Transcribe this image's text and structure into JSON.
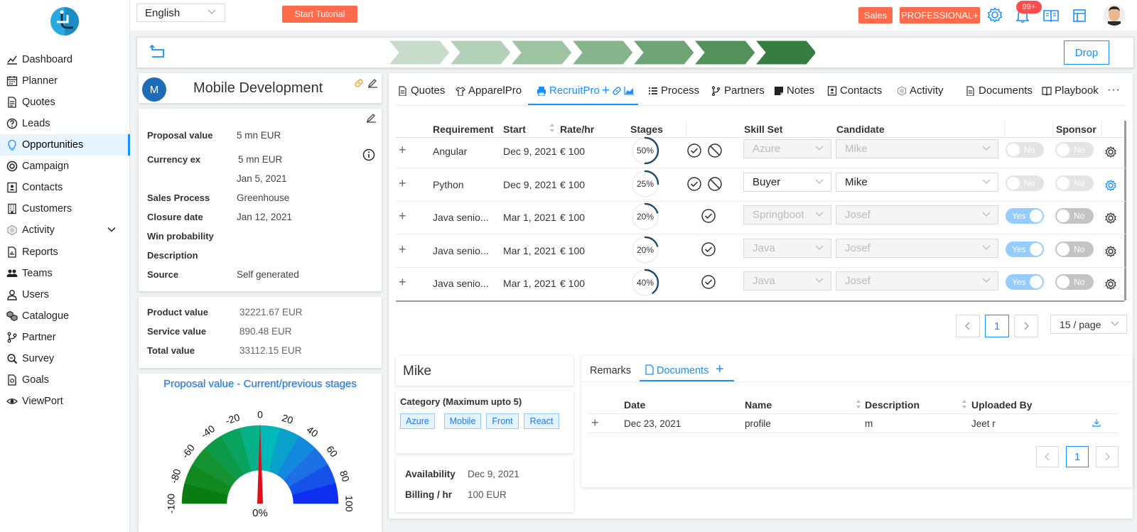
{
  "topbar": {
    "language": "English",
    "tutorial_label": "Start Tutorial",
    "sales_badge": "Sales",
    "plan_badge": "PROFESSIONAL+",
    "notifications_count": "99+"
  },
  "sidebar": {
    "items": [
      {
        "label": "Dashboard",
        "icon": "chart-line-icon"
      },
      {
        "label": "Planner",
        "icon": "calendar-icon"
      },
      {
        "label": "Quotes",
        "icon": "document-icon"
      },
      {
        "label": "Leads",
        "icon": "question-circle-icon"
      },
      {
        "label": "Opportunities",
        "icon": "bulb-icon"
      },
      {
        "label": "Campaign",
        "icon": "target-icon"
      },
      {
        "label": "Contacts",
        "icon": "contact-card-icon"
      },
      {
        "label": "Customers",
        "icon": "building-icon"
      },
      {
        "label": "Activity",
        "icon": "hexagon-icon"
      },
      {
        "label": "Reports",
        "icon": "report-icon"
      },
      {
        "label": "Teams",
        "icon": "team-icon"
      },
      {
        "label": "Users",
        "icon": "user-icon"
      },
      {
        "label": "Catalogue",
        "icon": "cubes-icon"
      },
      {
        "label": "Partner",
        "icon": "branch-icon"
      },
      {
        "label": "Survey",
        "icon": "search-doc-icon"
      },
      {
        "label": "Goals",
        "icon": "goal-doc-icon"
      },
      {
        "label": "ViewPort",
        "icon": "eye-icon"
      }
    ],
    "active": "Opportunities"
  },
  "stagebar": {
    "drop_label": "Drop",
    "stage_colors": [
      "#c7dccb",
      "#b3d0b8",
      "#9dc3a3",
      "#86b48d",
      "#6fa576",
      "#52915b",
      "#367d42"
    ]
  },
  "opportunity": {
    "avatar_letter": "M",
    "title": "Mobile Development",
    "details": [
      {
        "label": "Proposal value",
        "value": "5 mn EUR"
      },
      {
        "label": "Currency ex",
        "value": "5 mn EUR"
      },
      {
        "label": "",
        "value": "Jan 5, 2021"
      },
      {
        "label": "Sales Process",
        "value": "Greenhouse"
      },
      {
        "label": "Closure date",
        "value": "Jan 12, 2021"
      },
      {
        "label": "Win probability",
        "value": ""
      },
      {
        "label": "Description",
        "value": ""
      },
      {
        "label": "Source",
        "value": "Self generated"
      }
    ],
    "values": [
      {
        "label": "Product value",
        "value": "32221.67 EUR"
      },
      {
        "label": "Service value",
        "value": "890.48 EUR"
      },
      {
        "label": "Total value",
        "value": "33112.15 EUR"
      }
    ]
  },
  "gauge": {
    "title": "Proposal value - Current/previous stages",
    "ticks": [
      "-100",
      "-80",
      "-60",
      "-40",
      "-20",
      "0",
      "20",
      "40",
      "60",
      "80",
      "100"
    ],
    "value_text": "0%",
    "value": 0
  },
  "tabs": [
    {
      "label": "Quotes",
      "icon": "doc-icon"
    },
    {
      "label": "ApparelPro",
      "icon": "shirt-icon"
    },
    {
      "label": "RecruitPro",
      "icon": "printer-icon"
    },
    {
      "label": "Process",
      "icon": "list-icon"
    },
    {
      "label": "Partners",
      "icon": "branch-icon"
    },
    {
      "label": "Notes",
      "icon": "note-icon"
    },
    {
      "label": "Contacts",
      "icon": "contact-icon"
    },
    {
      "label": "Activity",
      "icon": "hexagon-icon"
    },
    {
      "label": "Documents",
      "icon": "doc-icon"
    },
    {
      "label": "Playbook",
      "icon": "book-icon"
    }
  ],
  "recruit_table": {
    "headers": {
      "requirement": "Requirement",
      "start": "Start",
      "rate": "Rate/hr",
      "stages": "Stages",
      "skill": "Skill Set",
      "candidate": "Candidate",
      "sponsor": "Sponsor"
    },
    "rows": [
      {
        "requirement": "Angular",
        "start": "Dec 9, 2021",
        "rate": "€ 100",
        "stage_text": "50%",
        "stage": 0.5,
        "skill": "Azure",
        "candidate": "Mike",
        "avail": "No",
        "avail_on": false,
        "sponsor": "No",
        "sponsor_on": false,
        "disabled": true,
        "icons": "check-block"
      },
      {
        "requirement": "Python",
        "start": "Dec 9, 2021",
        "rate": "€ 100",
        "stage_text": "25%",
        "stage": 0.25,
        "skill": "Buyer",
        "candidate": "Mike",
        "avail": "No",
        "avail_on": false,
        "sponsor": "No",
        "sponsor_on": false,
        "disabled": false,
        "icons": "check-block"
      },
      {
        "requirement": "Java senio...",
        "start": "Mar 1, 2021",
        "rate": "€ 100",
        "stage_text": "20%",
        "stage": 0.2,
        "skill": "Springboot",
        "candidate": "Josef",
        "avail": "Yes",
        "avail_on": true,
        "sponsor": "No",
        "sponsor_on": false,
        "disabled": true,
        "icons": "check"
      },
      {
        "requirement": "Java senio...",
        "start": "Mar 1, 2021",
        "rate": "€ 100",
        "stage_text": "20%",
        "stage": 0.2,
        "skill": "Java",
        "candidate": "Josef",
        "avail": "Yes",
        "avail_on": true,
        "sponsor": "No",
        "sponsor_on": false,
        "disabled": true,
        "icons": "check"
      },
      {
        "requirement": "Java senio...",
        "start": "Mar 1, 2021",
        "rate": "€ 100",
        "stage_text": "40%",
        "stage": 0.4,
        "skill": "Java",
        "candidate": "Josef",
        "avail": "Yes",
        "avail_on": true,
        "sponsor": "No",
        "sponsor_on": false,
        "disabled": true,
        "icons": "check"
      }
    ],
    "page": "1",
    "page_size": "15 / page"
  },
  "candidate": {
    "name": "Mike",
    "category_label": "Category (Maximum upto 5)",
    "tags": [
      "Azure",
      "Mobile",
      "Front",
      "React"
    ],
    "availability_label": "Availability",
    "availability_value": "Dec 9, 2021",
    "billing_label": "Billing / hr",
    "billing_value": "100 EUR"
  },
  "docs": {
    "tabs": [
      "Remarks",
      "Documents"
    ],
    "headers": {
      "date": "Date",
      "name": "Name",
      "description": "Description",
      "uploaded": "Uploaded By"
    },
    "rows": [
      {
        "date": "Dec 23, 2021",
        "name": "profile",
        "description": "m",
        "uploaded": "Jeet r"
      }
    ],
    "page": "1"
  }
}
